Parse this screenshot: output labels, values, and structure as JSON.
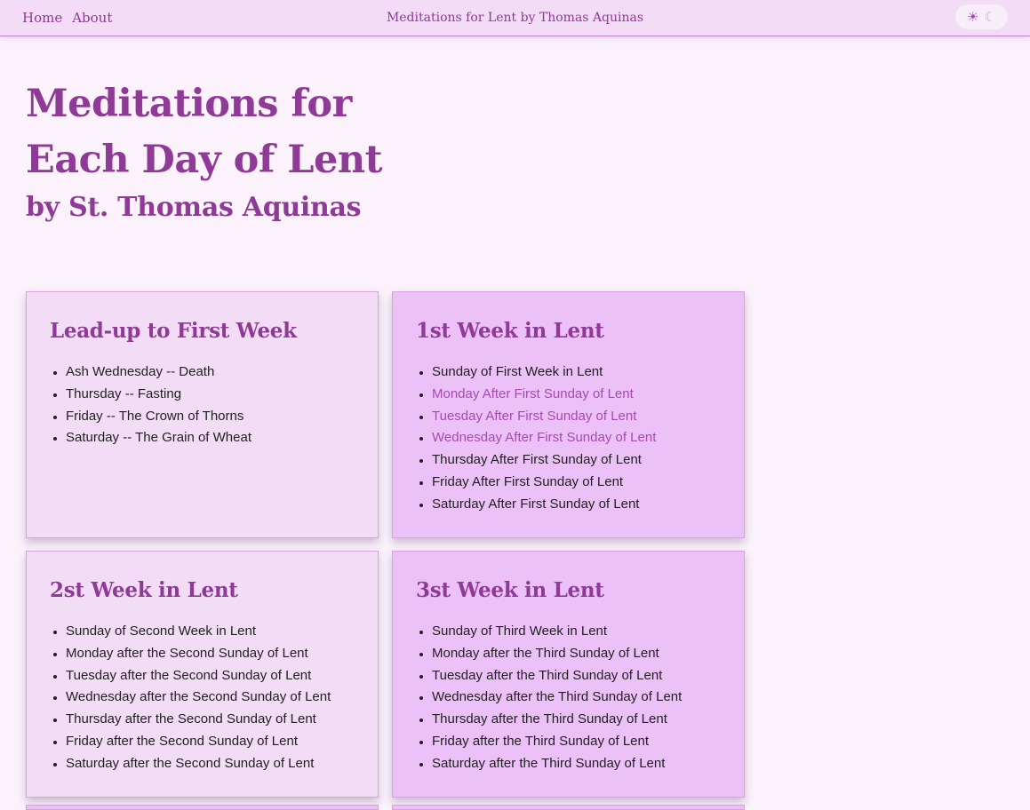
{
  "nav": {
    "home": "Home",
    "about": "About",
    "site_title": "Meditations for Lent by Thomas Aquinas",
    "theme_toggle": {
      "sun_icon": "☀",
      "moon_icon": "☾"
    }
  },
  "header": {
    "title": "Meditations for Each Day of Lent",
    "subtitle": "by St. Thomas Aquinas"
  },
  "colors": {
    "accent": "#8e3a96",
    "link": "#a54bb0",
    "background": "#fbf2fc",
    "card_light": "#f3dcf6",
    "card_dark": "#ecc1f7"
  },
  "cards": [
    {
      "title": "Lead-up to First Week",
      "items": [
        "Ash Wednesday -- Death",
        "Thursday -- Fasting",
        "Friday -- The Crown of Thorns",
        "Saturday -- The Grain of Wheat"
      ]
    },
    {
      "title": "1st Week in Lent",
      "items": [
        "Sunday of First Week in Lent",
        "Monday After First Sunday of Lent",
        "Tuesday After First Sunday of Lent",
        "Wednesday After First Sunday of Lent",
        "Thursday After First Sunday of Lent",
        "Friday After First Sunday of Lent",
        "Saturday After First Sunday of Lent"
      ]
    },
    {
      "title": "2st Week in Lent",
      "items": [
        "Sunday of Second Week in Lent",
        "Monday after the Second Sunday of Lent",
        "Tuesday after the Second Sunday of Lent",
        "Wednesday after the Second Sunday of Lent",
        "Thursday after the Second Sunday of Lent",
        "Friday after the Second Sunday of Lent",
        "Saturday after the Second Sunday of Lent"
      ]
    },
    {
      "title": "3st Week in Lent",
      "items": [
        "Sunday of Third Week in Lent",
        "Monday after the Third Sunday of Lent",
        "Tuesday after the Third Sunday of Lent",
        "Wednesday after the Third Sunday of Lent",
        "Thursday after the Third Sunday of Lent",
        "Friday after the Third Sunday of Lent",
        "Saturday after the Third Sunday of Lent"
      ]
    }
  ]
}
